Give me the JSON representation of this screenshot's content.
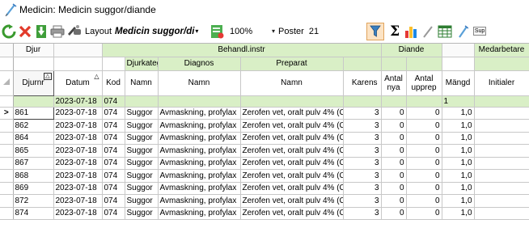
{
  "window": {
    "title": "Medicin: Medicin suggor/diande"
  },
  "toolbar": {
    "layout_label": "Layout",
    "layout_value": "Medicin suggor/di",
    "zoom_value": "100%",
    "poster_label": "Poster",
    "poster_count": "21",
    "sum_symbol": "Σ",
    "sup_label": "Sup"
  },
  "grid": {
    "groups": {
      "djur": "Djur",
      "behandl": "Behandl.instr",
      "diande": "Diande",
      "medarbetare": "Medarbetare"
    },
    "subgroups": {
      "djurkategori": "Djurkategor",
      "diagnos": "Diagnos",
      "preparat": "Preparat"
    },
    "columns": {
      "djurnr": "Djurnr",
      "datum": "Datum",
      "kod": "Kod",
      "djurkat_namn": "Namn",
      "diagnos_namn": "Namn",
      "preparat_namn": "Namn",
      "karens": "Karens",
      "antal_nya": "Antal nya",
      "antal_upprep": "Antal upprep",
      "mangd": "Mängd",
      "initialer": "Initialer"
    },
    "filter": {
      "datum": "2023-07-18",
      "kod": "074",
      "mangd": "1"
    },
    "current_row_marker": ">",
    "rows": [
      {
        "djurnr": "861",
        "datum": "2023-07-18",
        "kod": "074",
        "namn": "Suggor",
        "diagnos": "Avmaskning, profylax",
        "preparat": "Zerofen vet, oralt pulv 4% (C",
        "karens": "3",
        "nya": "0",
        "upprep": "0",
        "mangd": "1,0",
        "initialer": ""
      },
      {
        "djurnr": "862",
        "datum": "2023-07-18",
        "kod": "074",
        "namn": "Suggor",
        "diagnos": "Avmaskning, profylax",
        "preparat": "Zerofen vet, oralt pulv 4% (C",
        "karens": "3",
        "nya": "0",
        "upprep": "0",
        "mangd": "1,0",
        "initialer": ""
      },
      {
        "djurnr": "864",
        "datum": "2023-07-18",
        "kod": "074",
        "namn": "Suggor",
        "diagnos": "Avmaskning, profylax",
        "preparat": "Zerofen vet, oralt pulv 4% (C",
        "karens": "3",
        "nya": "0",
        "upprep": "0",
        "mangd": "1,0",
        "initialer": ""
      },
      {
        "djurnr": "865",
        "datum": "2023-07-18",
        "kod": "074",
        "namn": "Suggor",
        "diagnos": "Avmaskning, profylax",
        "preparat": "Zerofen vet, oralt pulv 4% (C",
        "karens": "3",
        "nya": "0",
        "upprep": "0",
        "mangd": "1,0",
        "initialer": ""
      },
      {
        "djurnr": "867",
        "datum": "2023-07-18",
        "kod": "074",
        "namn": "Suggor",
        "diagnos": "Avmaskning, profylax",
        "preparat": "Zerofen vet, oralt pulv 4% (C",
        "karens": "3",
        "nya": "0",
        "upprep": "0",
        "mangd": "1,0",
        "initialer": ""
      },
      {
        "djurnr": "868",
        "datum": "2023-07-18",
        "kod": "074",
        "namn": "Suggor",
        "diagnos": "Avmaskning, profylax",
        "preparat": "Zerofen vet, oralt pulv 4% (C",
        "karens": "3",
        "nya": "0",
        "upprep": "0",
        "mangd": "1,0",
        "initialer": ""
      },
      {
        "djurnr": "869",
        "datum": "2023-07-18",
        "kod": "074",
        "namn": "Suggor",
        "diagnos": "Avmaskning, profylax",
        "preparat": "Zerofen vet, oralt pulv 4% (C",
        "karens": "3",
        "nya": "0",
        "upprep": "0",
        "mangd": "1,0",
        "initialer": ""
      },
      {
        "djurnr": "872",
        "datum": "2023-07-18",
        "kod": "074",
        "namn": "Suggor",
        "diagnos": "Avmaskning, profylax",
        "preparat": "Zerofen vet, oralt pulv 4% (C",
        "karens": "3",
        "nya": "0",
        "upprep": "0",
        "mangd": "1,0",
        "initialer": ""
      },
      {
        "djurnr": "874",
        "datum": "2023-07-18",
        "kod": "074",
        "namn": "Suggor",
        "diagnos": "Avmaskning, profylax",
        "preparat": "Zerofen vet, oralt pulv 4% (C",
        "karens": "3",
        "nya": "0",
        "upprep": "0",
        "mangd": "1,0",
        "initialer": ""
      }
    ]
  }
}
